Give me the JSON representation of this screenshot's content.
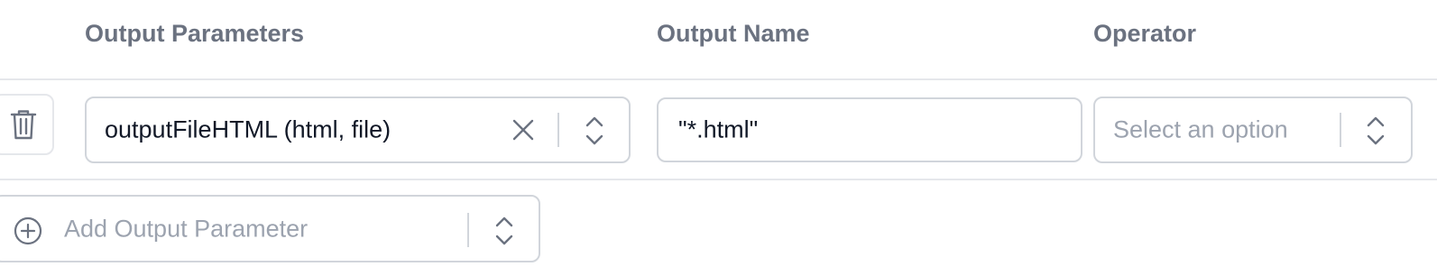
{
  "headers": {
    "output_parameters": "Output Parameters",
    "output_name": "Output Name",
    "operator": "Operator"
  },
  "row": {
    "output_parameter_value": "outputFileHTML (html, file)",
    "output_name_value": "\"*.html\"",
    "operator_placeholder": "Select an option"
  },
  "add_output_parameter": {
    "placeholder": "Add Output Parameter"
  },
  "icons": {
    "delete": "trash-icon",
    "clear": "close-icon",
    "select": "chevron-up-down-icon",
    "add": "plus-circle-icon"
  },
  "colors": {
    "header_text": "#6b7280",
    "value_text": "#111827",
    "placeholder_text": "#9ca3af",
    "border": "#d1d5db",
    "divider": "#e5e7eb"
  }
}
